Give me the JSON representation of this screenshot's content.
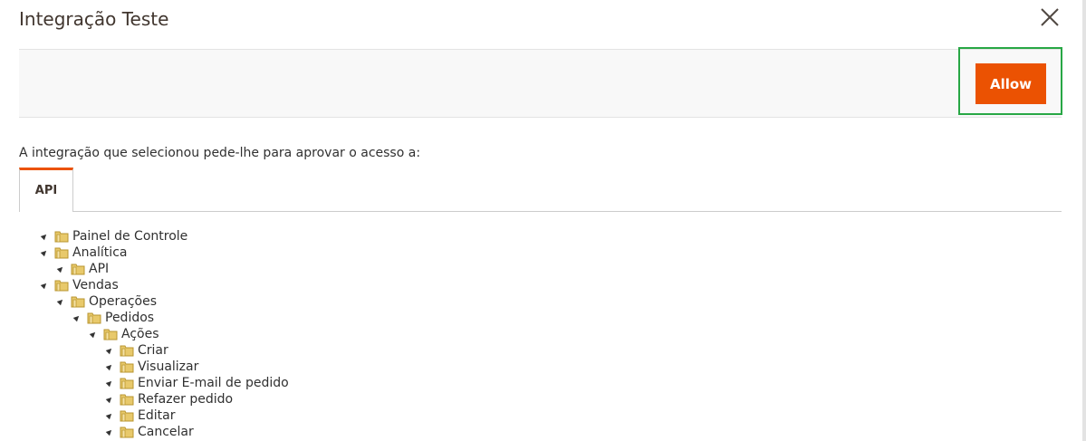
{
  "dialog": {
    "title": "Integração Teste",
    "allow_label": "Allow",
    "intro": "A integração que selecionou pede-lhe para aprovar o acesso a:",
    "tab_label": "API"
  },
  "colors": {
    "accent": "#eb5202",
    "highlight_border": "#28a745",
    "actions_bar_bg": "#f8f8f8",
    "folder": "#e8c96b"
  },
  "tree": {
    "items": [
      {
        "label": "Painel de Controle",
        "level": 0
      },
      {
        "label": "Analítica",
        "level": 0
      },
      {
        "label": "API",
        "level": 1
      },
      {
        "label": "Vendas",
        "level": 0
      },
      {
        "label": "Operações",
        "level": 1
      },
      {
        "label": "Pedidos",
        "level": 2
      },
      {
        "label": "Ações",
        "level": 3
      },
      {
        "label": "Criar",
        "level": 4
      },
      {
        "label": "Visualizar",
        "level": 4
      },
      {
        "label": "Enviar E-mail de pedido",
        "level": 4
      },
      {
        "label": "Refazer pedido",
        "level": 4
      },
      {
        "label": "Editar",
        "level": 4
      },
      {
        "label": "Cancelar",
        "level": 4
      }
    ]
  }
}
